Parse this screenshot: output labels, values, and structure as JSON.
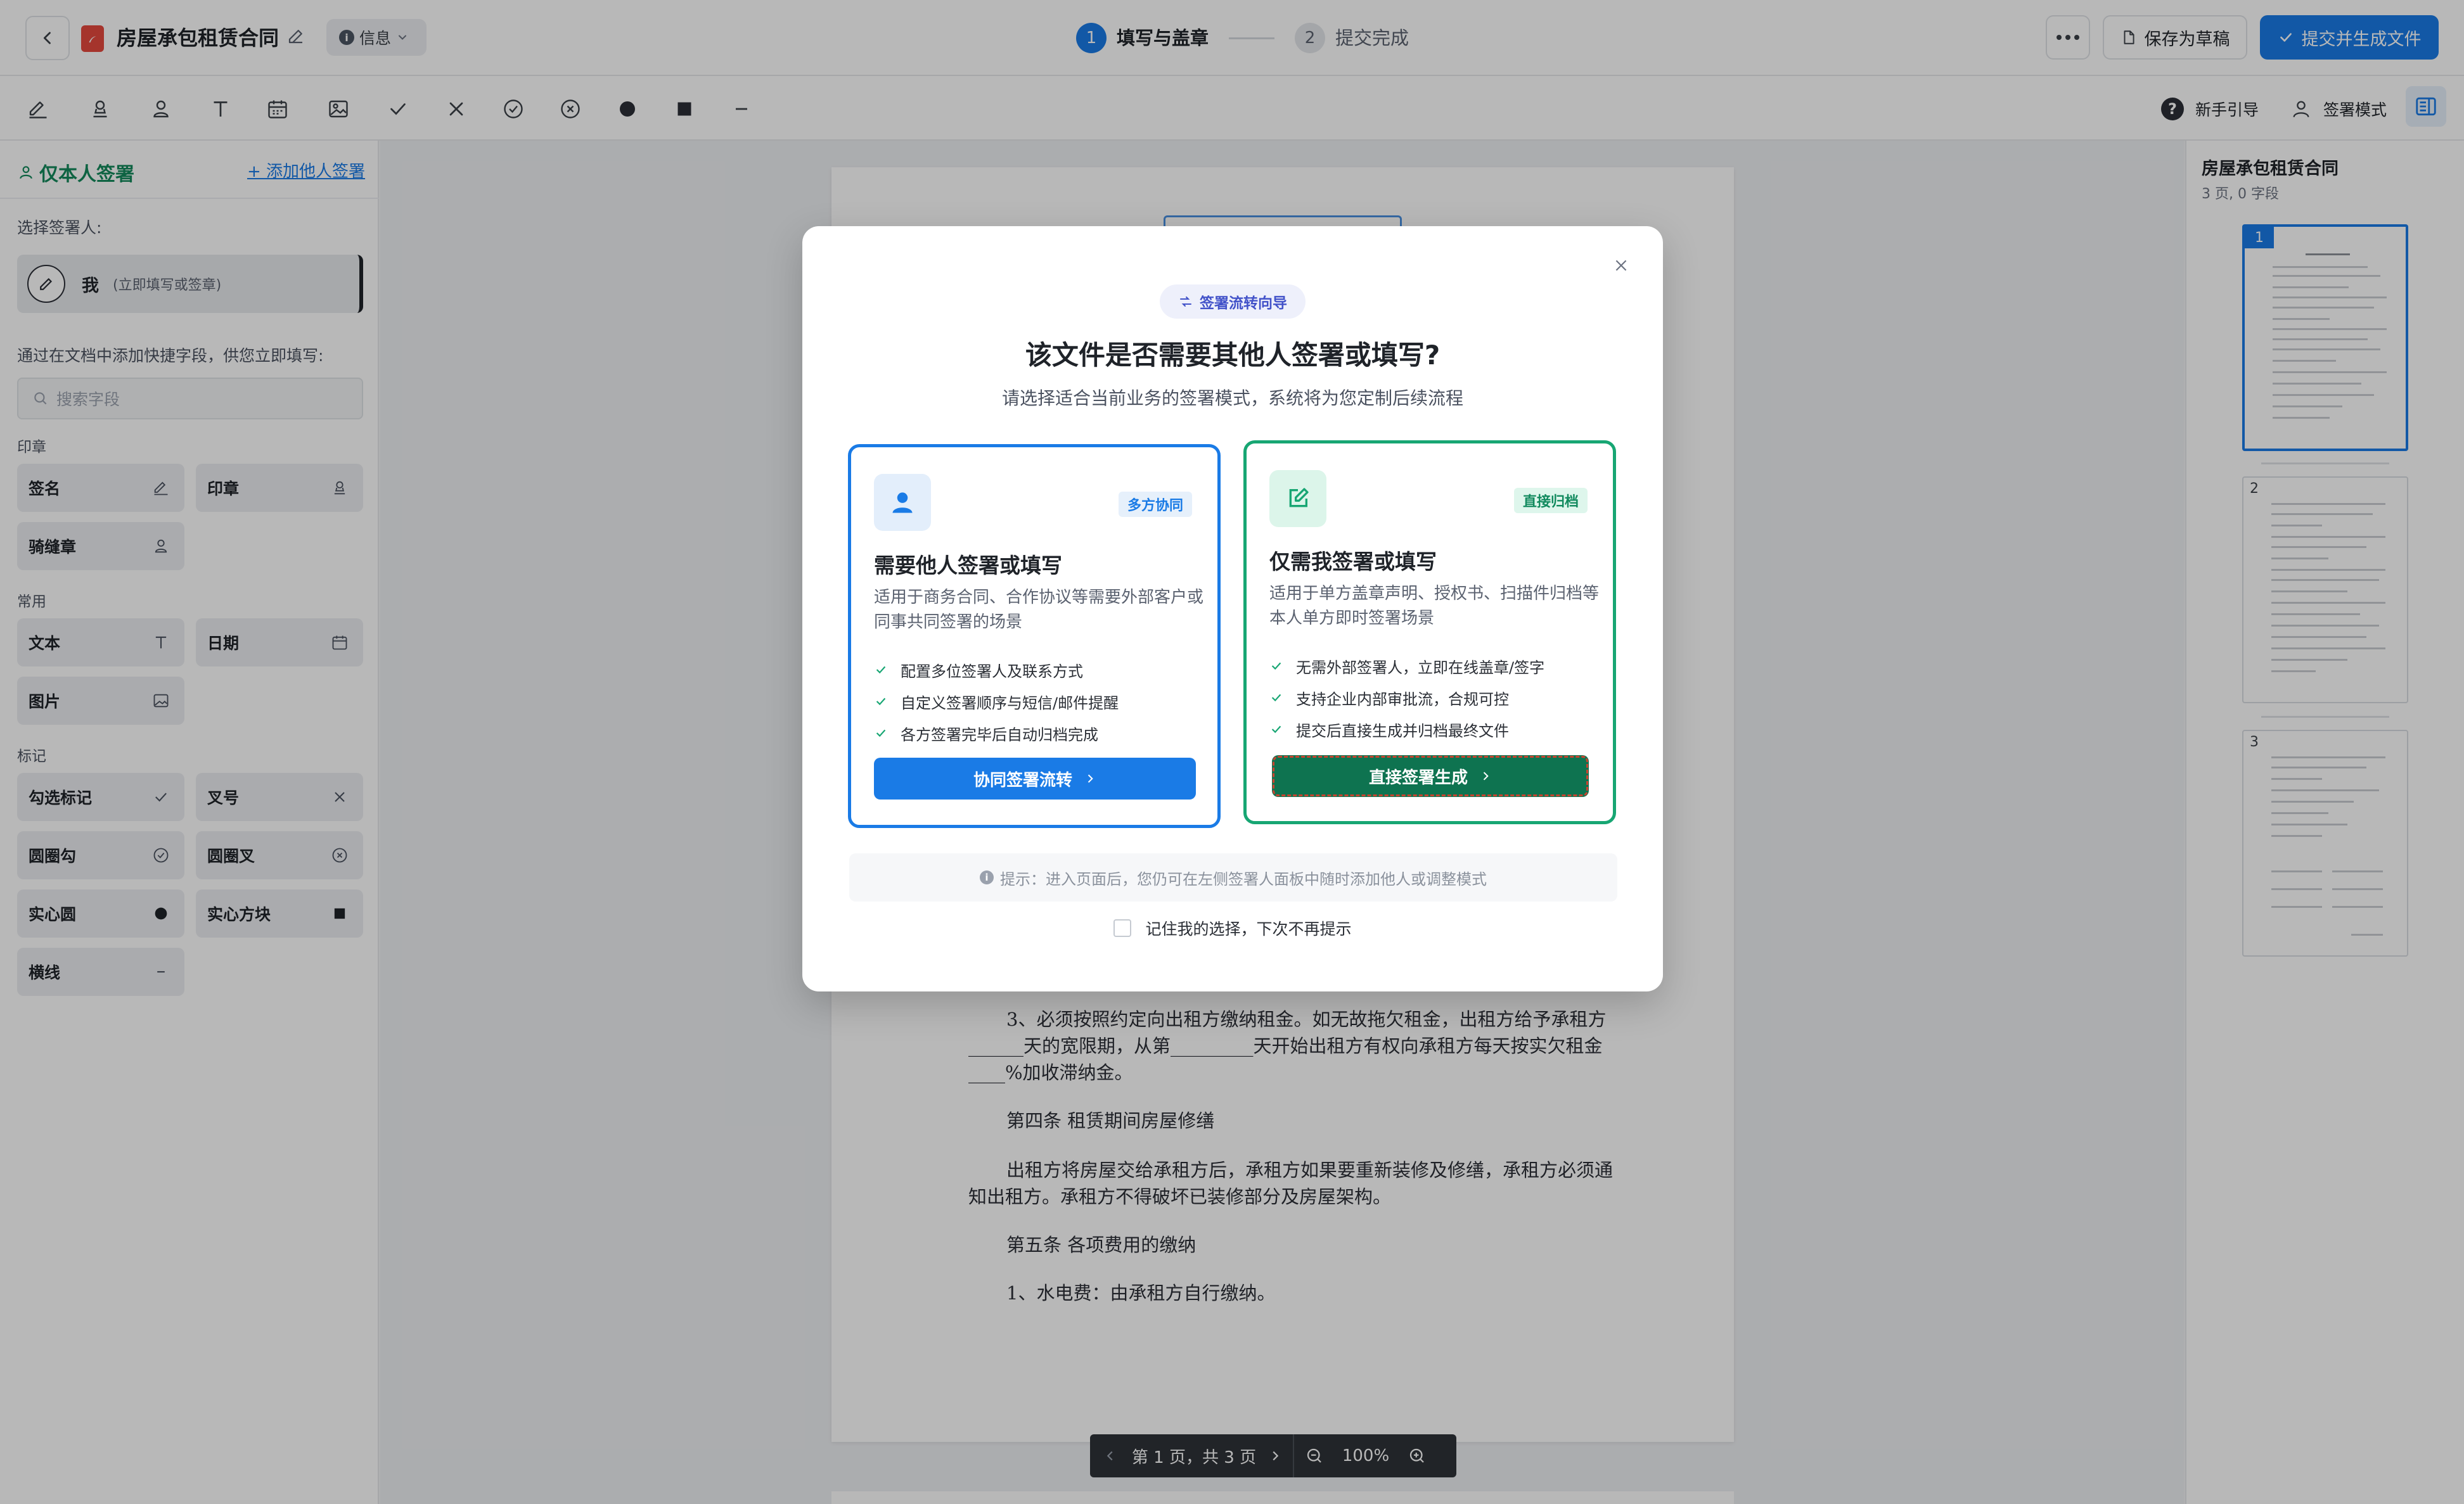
{
  "header": {
    "title": "房屋承包租赁合同",
    "info_label": "信息",
    "steps": [
      {
        "num": "1",
        "label": "填写与盖章"
      },
      {
        "num": "2",
        "label": "提交完成"
      }
    ],
    "save_draft": "保存为草稿",
    "submit": "提交并生成文件"
  },
  "toolbar": {
    "guide": "新手引导",
    "sign_mode": "签署模式",
    "tools": [
      "signature-icon",
      "seal-icon",
      "person-seal-icon",
      "text-icon",
      "date-icon",
      "image-icon",
      "check-icon",
      "cross-icon",
      "circle-check-icon",
      "circle-cross-icon",
      "filled-circle-icon",
      "filled-square-icon",
      "line-icon"
    ]
  },
  "sidebar": {
    "title": "仅本人签署",
    "add_signer": "+ 添加他人签署",
    "select_signer_label": "选择签署人:",
    "signer": {
      "name": "我",
      "sub": "(立即填写或签章)"
    },
    "quick_fields_label": "通过在文档中添加快捷字段，供您立即填写:",
    "search_placeholder": "搜索字段",
    "sections": {
      "seal": "印章",
      "common": "常用",
      "mark": "标记"
    },
    "fields": {
      "signature": "签名",
      "seal": "印章",
      "riding_seal": "骑缝章",
      "text": "文本",
      "date": "日期",
      "image": "图片",
      "check": "勾选标记",
      "cross": "叉号",
      "circle_check": "圆圈勾",
      "circle_cross": "圆圈叉",
      "solid_circle": "实心圆",
      "solid_square": "实心方块",
      "line": "横线"
    }
  },
  "document": {
    "lines": [
      "3、必须按照约定向出租方缴纳租金。如无故拖欠租金，出租方给予承租方",
      "______天的宽限期，从第_________天开始出租方有权向承租方每天按实欠租金",
      "____%加收滞纳金。",
      "第四条    租赁期间房屋修缮",
      "出租方将房屋交给承租方后，承租方如果要重新装修及修缮，承租方必须通",
      "知出租方。承租方不得破坏已装修部分及房屋架构。",
      "第五条    各项费用的缴纳",
      "1、水电费：由承租方自行缴纳。"
    ]
  },
  "pager": {
    "page_text": "第 1 页，共 3 页",
    "zoom": "100%"
  },
  "right_panel": {
    "title": "房屋承包租赁合同",
    "sub": "3 页, 0 字段",
    "pages": [
      "1",
      "2",
      "3"
    ]
  },
  "modal": {
    "pill": "签署流转向导",
    "title": "该文件是否需要其他人签署或填写?",
    "subtitle": "请选择适合当前业务的签署模式，系统将为您定制后续流程",
    "multi": {
      "badge": "多方协同",
      "heading": "需要他人签署或填写",
      "desc": "适用于商务合同、合作协议等需要外部客户或同事共同签署的场景",
      "points": [
        "配置多位签署人及联系方式",
        "自定义签署顺序与短信/邮件提醒",
        "各方签署完毕后自动归档完成"
      ],
      "cta": "协同签署流转"
    },
    "self": {
      "badge": "直接归档",
      "heading": "仅需我签署或填写",
      "desc": "适用于单方盖章声明、授权书、扫描件归档等本人单方即时签署场景",
      "points": [
        "无需外部签署人，立即在线盖章/签字",
        "支持企业内部审批流，合规可控",
        "提交后直接生成并归档最终文件"
      ],
      "cta": "直接签署生成"
    },
    "hint": "提示：进入页面后，您仍可在左侧签署人面板中随时添加他人或调整模式",
    "remember": "记住我的选择，下次不再提示"
  },
  "colors": {
    "primary": "#1a7be6",
    "success": "#17a673",
    "success_dark": "#0e7350",
    "pdf_red": "#e5483d"
  }
}
